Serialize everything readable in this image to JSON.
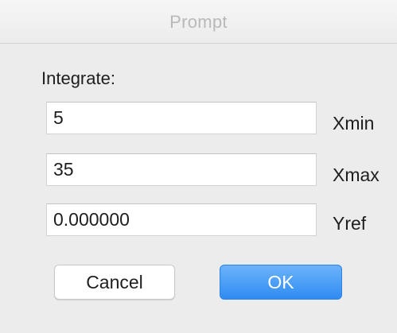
{
  "window": {
    "title": "Prompt"
  },
  "form": {
    "section_label": "Integrate:",
    "fields": [
      {
        "value": "5",
        "label": "Xmin"
      },
      {
        "value": "35",
        "label": "Xmax"
      },
      {
        "value": "0.000000",
        "label": "Yref"
      }
    ]
  },
  "buttons": {
    "cancel_label": "Cancel",
    "ok_label": "OK"
  },
  "colors": {
    "accent": "#3d94f6",
    "background": "#ececec"
  }
}
